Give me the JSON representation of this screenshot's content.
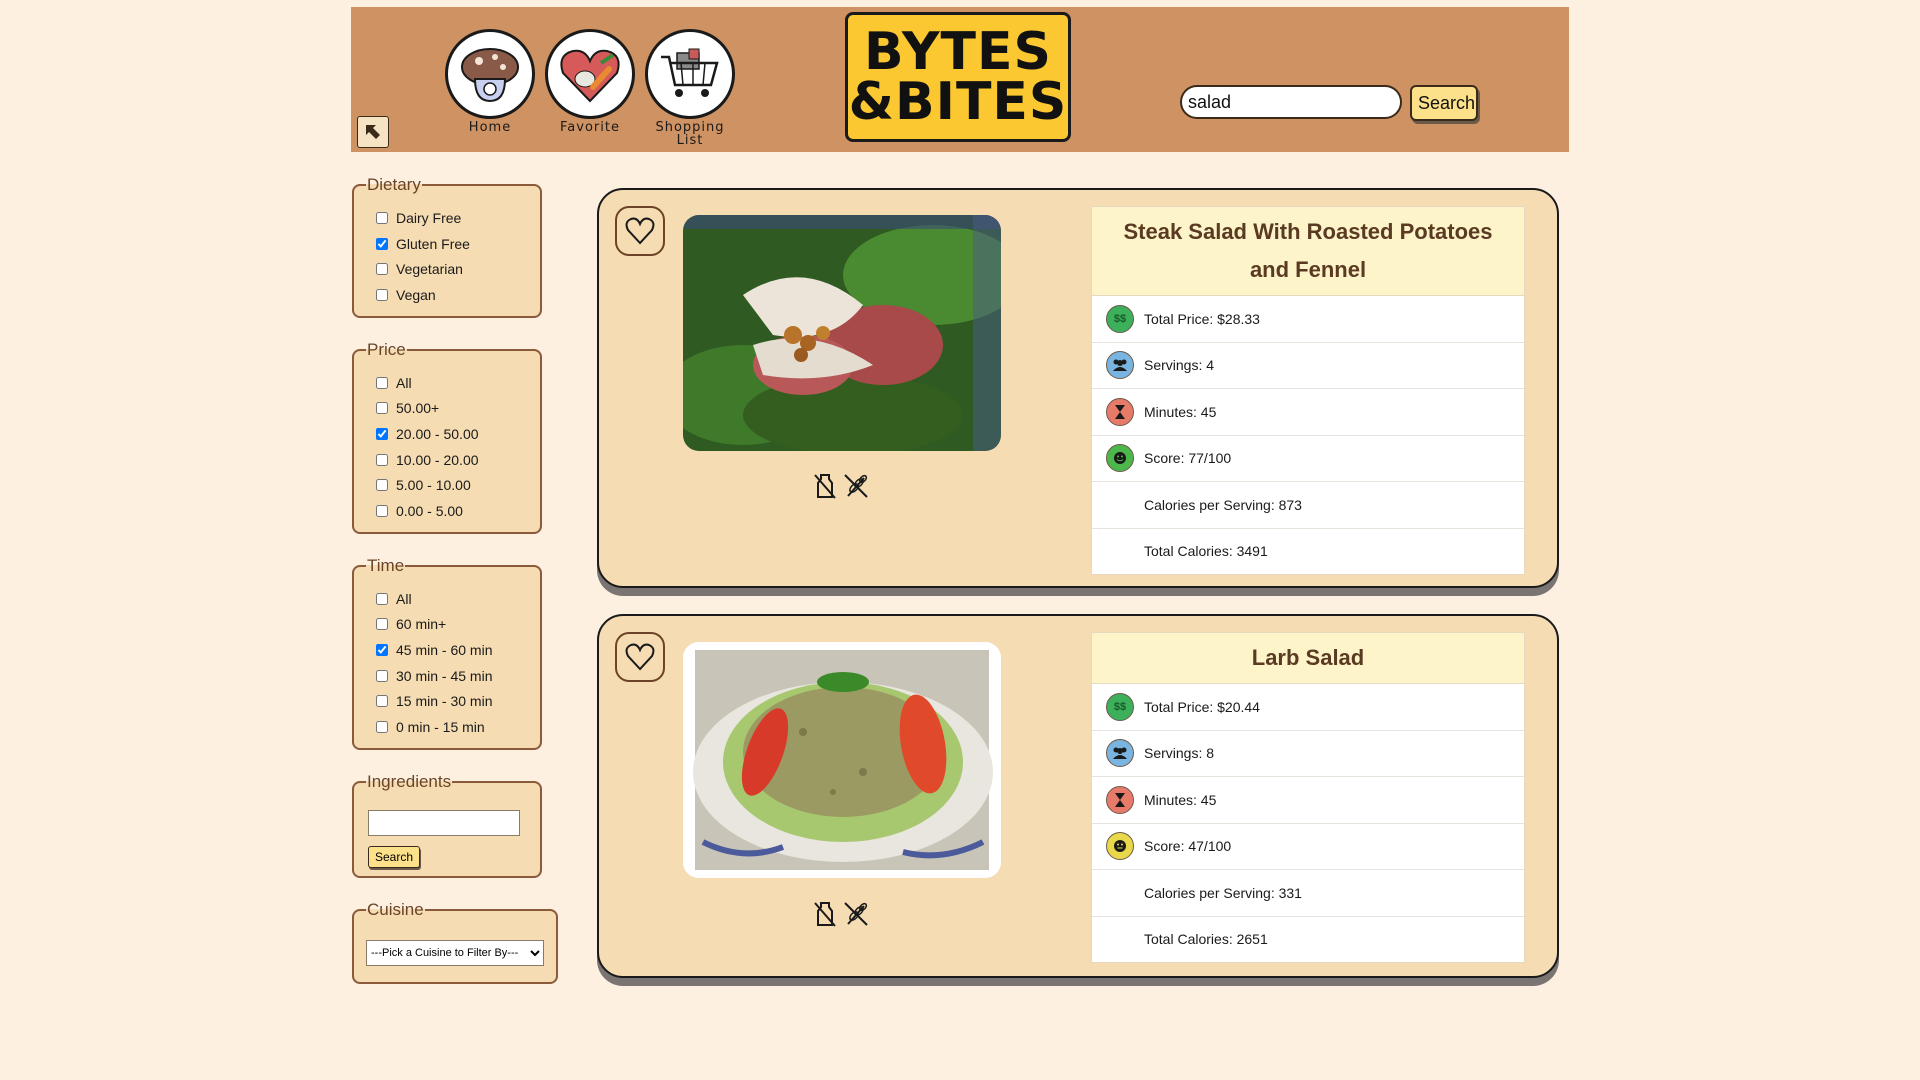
{
  "header": {
    "nav": [
      {
        "label": "Home",
        "icon": "mushroom-house-icon"
      },
      {
        "label": "Favorite",
        "icon": "heart-vegetables-icon"
      },
      {
        "label": "Shopping\nList",
        "icon": "shopping-cart-icon"
      }
    ],
    "logo_line1": "BYTES",
    "logo_line2": "&BITES",
    "search_value": "salad",
    "search_button": "Search"
  },
  "filters": {
    "dietary": {
      "legend": "Dietary",
      "options": [
        {
          "label": "Dairy Free",
          "checked": false
        },
        {
          "label": "Gluten Free",
          "checked": true
        },
        {
          "label": "Vegetarian",
          "checked": false
        },
        {
          "label": "Vegan",
          "checked": false
        }
      ]
    },
    "price": {
      "legend": "Price",
      "options": [
        {
          "label": "All",
          "checked": false
        },
        {
          "label": "50.00+",
          "checked": false
        },
        {
          "label": "20.00 - 50.00",
          "checked": true
        },
        {
          "label": "10.00 - 20.00",
          "checked": false
        },
        {
          "label": "5.00 - 10.00",
          "checked": false
        },
        {
          "label": "0.00 - 5.00",
          "checked": false
        }
      ]
    },
    "time": {
      "legend": "Time",
      "options": [
        {
          "label": "All",
          "checked": false
        },
        {
          "label": "60 min+",
          "checked": false
        },
        {
          "label": "45 min - 60 min",
          "checked": true
        },
        {
          "label": "30 min - 45 min",
          "checked": false
        },
        {
          "label": "15 min - 30 min",
          "checked": false
        },
        {
          "label": "0 min - 15 min",
          "checked": false
        }
      ]
    },
    "ingredients": {
      "legend": "Ingredients",
      "value": "",
      "button": "Search"
    },
    "cuisine": {
      "legend": "Cuisine",
      "selected": "---Pick a Cuisine to Filter By---"
    }
  },
  "recipes": [
    {
      "title": "Steak Salad With Roasted Potatoes and Fennel",
      "price": "Total Price: $28.33",
      "servings": "Servings: 4",
      "minutes": "Minutes: 45",
      "score": "Score: 77/100",
      "calories_serving": "Calories per Serving: 873",
      "calories_total": "Total Calories: 3491",
      "score_color": "#4cb84c"
    },
    {
      "title": "Larb Salad",
      "price": "Total Price: $20.44",
      "servings": "Servings: 8",
      "minutes": "Minutes: 45",
      "score": "Score: 47/100",
      "calories_serving": "Calories per Serving: 331",
      "calories_total": "Total Calories: 2651",
      "score_color": "#e8d84a"
    }
  ],
  "colors": {
    "header": "#cf9262",
    "card": "#f5dcb3",
    "logo": "#fbc831",
    "background": "#fdf0e0"
  }
}
